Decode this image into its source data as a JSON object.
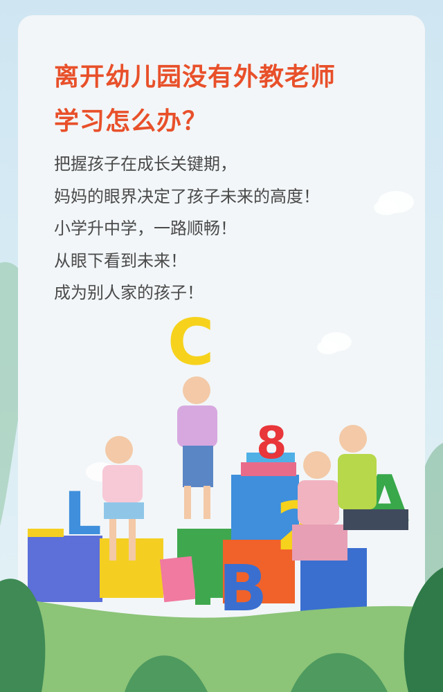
{
  "headline": {
    "line1": "离开幼儿园没有外教老师",
    "line2": "学习怎么办？"
  },
  "body_lines": [
    "把握孩子在成长关键期，",
    "妈妈的眼界决定了孩子未来的高度！",
    "小学升中学，一路顺畅！",
    "从眼下看到未来！",
    "成为别人家的孩子！"
  ],
  "letters": {
    "top": "C",
    "left_block": "L",
    "bottom_block": "B",
    "number_red": "8",
    "number_yellow": "2",
    "letter_green": "A"
  },
  "colors": {
    "headline": "#e8502a",
    "body": "#4a4a4a",
    "card": "#f2f6f8",
    "leaf_green": "#3f8a55"
  }
}
